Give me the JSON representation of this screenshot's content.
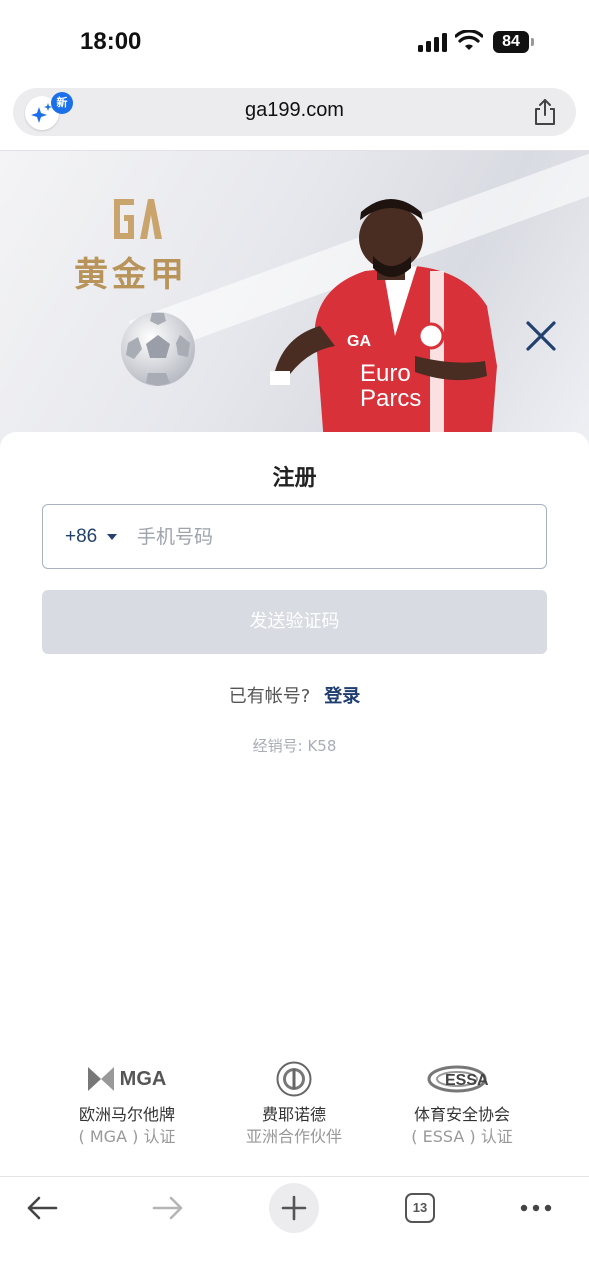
{
  "status_bar": {
    "time": "18:00",
    "battery": "84"
  },
  "address_bar": {
    "url": "ga199.com",
    "new_badge": "新"
  },
  "hero": {
    "brand_name": "黄金甲"
  },
  "register": {
    "title": "注册",
    "country_code": "+86",
    "phone_placeholder": "手机号码",
    "send_code_label": "发送验证码",
    "have_account": "已有帐号?",
    "login_label": "登录",
    "dealer": "经销号: K58"
  },
  "partners": [
    {
      "logo_text": "MGA",
      "name": "欧洲马尔他牌",
      "sub": "( MGA ) 认证"
    },
    {
      "logo_text": "",
      "name": "费耶诺德",
      "sub": "亚洲合作伙伴"
    },
    {
      "logo_text": "ESSA",
      "name": "体育安全协会",
      "sub": "( ESSA ) 认证"
    }
  ],
  "toolbar": {
    "tab_count": "13"
  },
  "colors": {
    "accent": "#1f3d70",
    "brand_gold": "#b8935a",
    "disabled_button": "#d8dbe2"
  }
}
